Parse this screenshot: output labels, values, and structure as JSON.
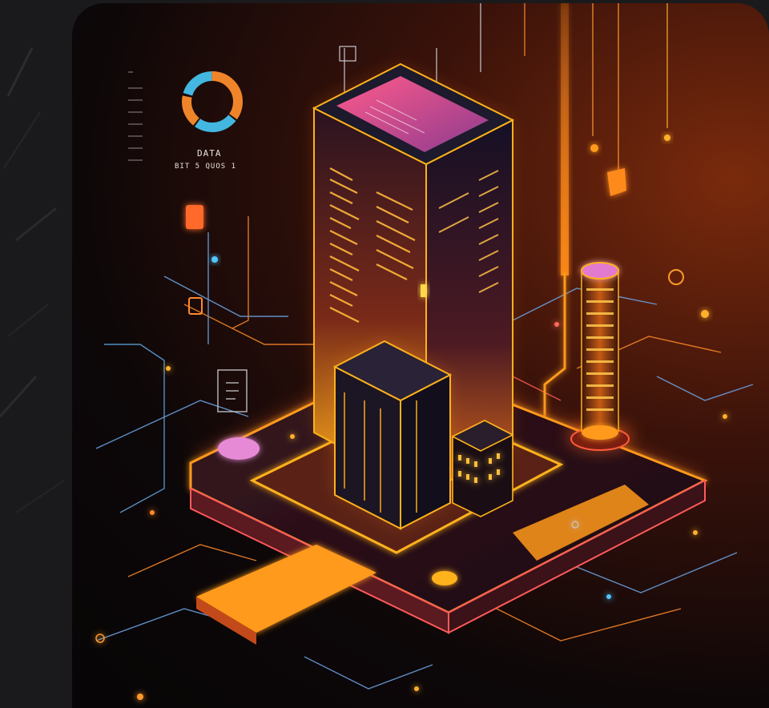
{
  "illustration": {
    "subject": "isometric-neon-data-center",
    "chart_label": "DATA",
    "chart_sublabel": "BIT 5 QUOS 1",
    "donut_segments_colors": [
      "#f0842a",
      "#43b7e0",
      "#f0842a",
      "#43b7e0"
    ],
    "palette": {
      "accent_orange": "#ff9a1a",
      "accent_pink": "#ff4f7b",
      "accent_cyan": "#4fc7ff",
      "background_dark": "#0b0607"
    }
  }
}
